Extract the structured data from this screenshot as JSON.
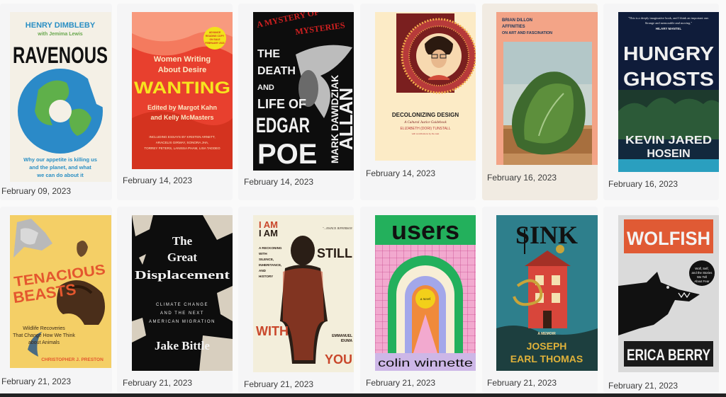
{
  "books": [
    {
      "date": "February 09, 2023",
      "lines": [
        "HENRY DIMBLEBY",
        "with Jemima Lewis",
        "RAVENOUS",
        "Why our appetite is killing us",
        "and the planet, and what",
        "we can do about it"
      ]
    },
    {
      "date": "February 14, 2023",
      "lines": [
        "ADVANCE READING COPY ON SALE FEBRUARY 2023",
        "Women Writing",
        "About Desire",
        "WANTING",
        "Edited by Margot Kahn",
        "and Kelly McMasters",
        "INCLUDING ESSAYS BY KRISTEN ARNETT, ARACELIS GIRMAY, SONORA JHA, TORREY PETERS, LANISSA PHAM, LISA TADDEO"
      ]
    },
    {
      "date": "February 14, 2023",
      "lines": [
        "A MYSTERY OF MYSTERIES",
        "THE DEATH AND LIFE OF",
        "EDGAR",
        "POE",
        "MARK DAWIDZIAK",
        "ALLAN"
      ]
    },
    {
      "date": "February 14, 2023",
      "lines": [
        "DECOLONIZING DESIGN",
        "A Cultural Justice Guidebook",
        "ELIZABETH (DORI) TUNSTALL"
      ]
    },
    {
      "date": "February 16, 2023",
      "lines": [
        "BRIAN DILLON",
        "AFFINITIES",
        "ON ART AND FASCINATION"
      ]
    },
    {
      "date": "February 16, 2023",
      "lines": [
        "\"This is a deeply imaginative book, and I think an important one. Strange and memorable and moving.\"",
        "HILARY MANTEL",
        "HUNGRY",
        "GHOSTS",
        "KEVIN JARED",
        "HOSEIN"
      ]
    },
    {
      "date": "February 21, 2023",
      "lines": [
        "TENACIOUS",
        "BEASTS",
        "Wildlife Recoveries",
        "That Change How We Think",
        "about Animals",
        "CHRISTOPHER J. PRESTON"
      ]
    },
    {
      "date": "February 21, 2023",
      "lines": [
        "The",
        "Great",
        "Displacement",
        "CLIMATE CHANGE",
        "AND THE NEXT",
        "AMERICAN MIGRATION",
        "Jake Bittle"
      ]
    },
    {
      "date": "February 21, 2023",
      "lines": [
        "I AM",
        "STILL",
        "WITH",
        "YOU",
        "A RECKONING WITH SILENCE, INHERITANCE, AND HISTORY",
        "EMMANUEL IDUMA",
        "\"...JEANCE JEFFERSON"
      ]
    },
    {
      "date": "February 21, 2023",
      "lines": [
        "users",
        "a novel",
        "colin winnette"
      ]
    },
    {
      "date": "February 21, 2023",
      "lines": [
        "SINK",
        "A MEMOIR",
        "JOSEPH",
        "EARL THOMAS"
      ]
    },
    {
      "date": "February 21, 2023",
      "lines": [
        "WOLFISH",
        "Wolf, Self, and the Stories We Tell About Fear",
        "ERICA BERRY"
      ]
    }
  ]
}
